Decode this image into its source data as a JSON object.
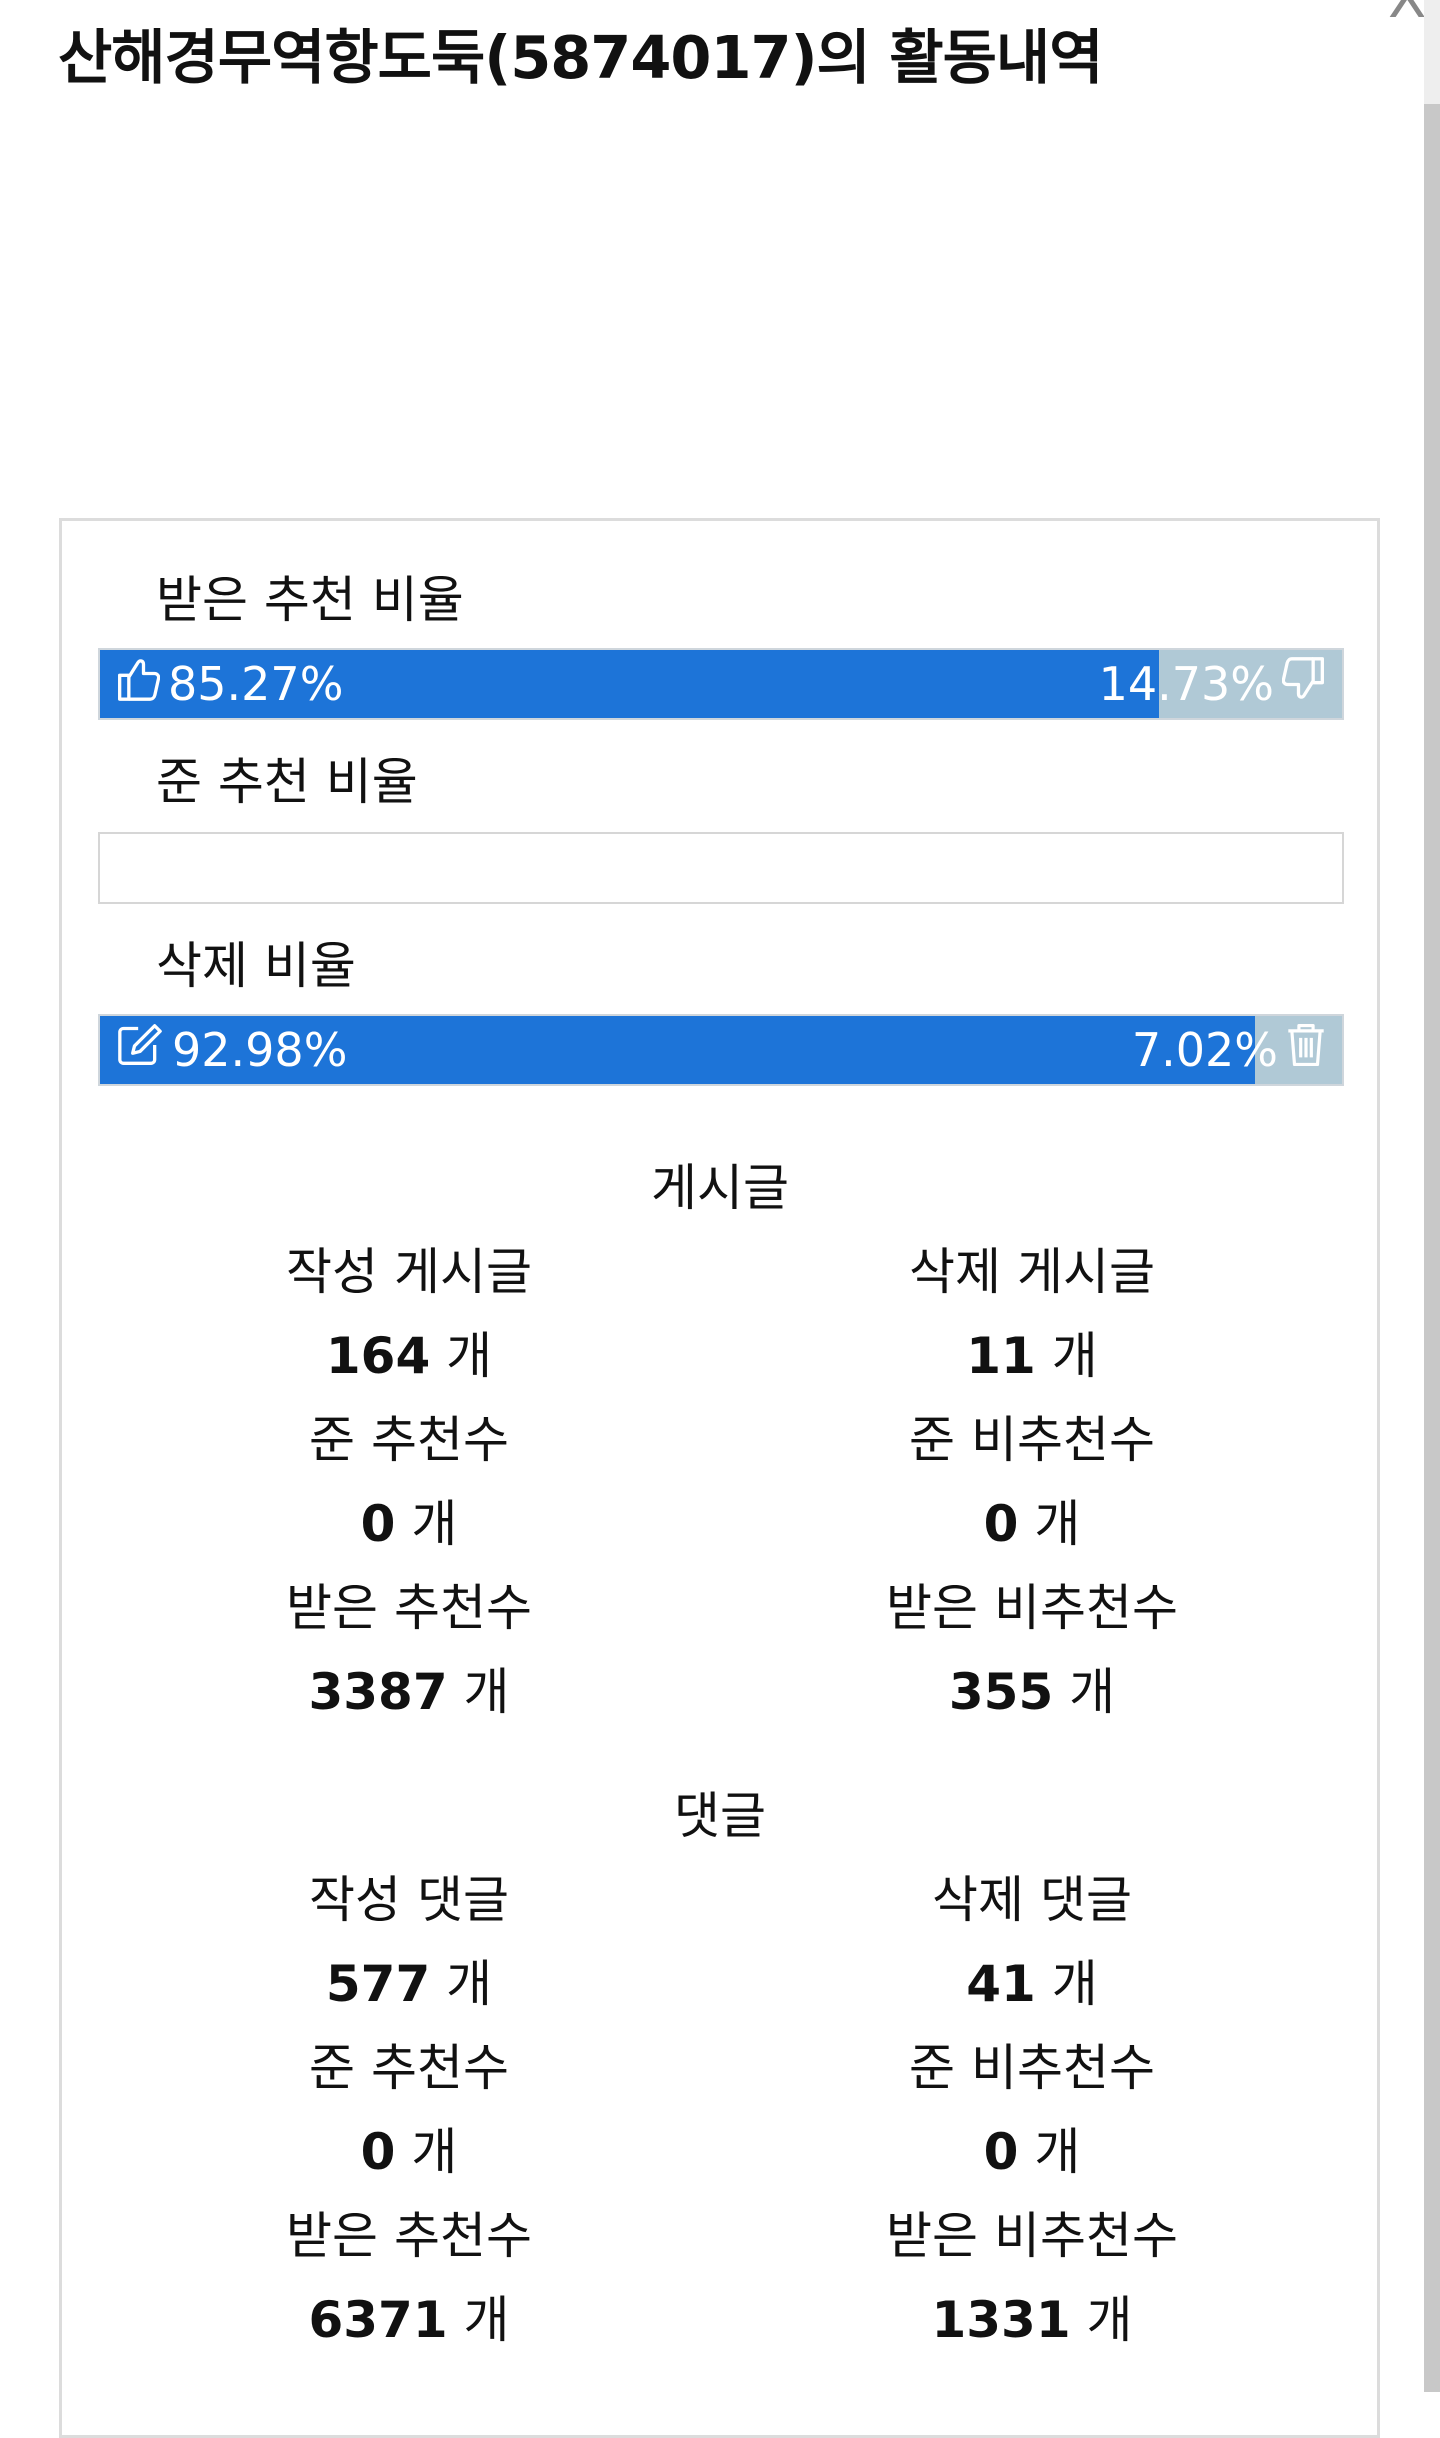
{
  "header": {
    "title": "산해경무역항도둑(5874017)의 활동내역",
    "close_label": "X"
  },
  "colors": {
    "bar_primary": "#1d74d8",
    "bar_secondary": "#b0c9d6",
    "panel_border": "#dcdcdc"
  },
  "ratios": {
    "received_recommend": {
      "label": "받은 추천 비율",
      "left_value": 85.27,
      "left_text": "85.27%",
      "left_icon": "thumbs-up-icon",
      "right_text": "14.73%",
      "right_icon": "thumbs-down-icon"
    },
    "given_recommend": {
      "label": "준 추천 비율"
    },
    "deleted": {
      "label": "삭제 비율",
      "left_value": 92.98,
      "left_text": "92.98%",
      "left_icon": "edit-icon",
      "right_text": "7.02%",
      "right_icon": "trash-icon"
    }
  },
  "posts": {
    "title": "게시글",
    "unit": "개",
    "written": {
      "label": "작성 게시글",
      "value": "164"
    },
    "deleted": {
      "label": "삭제 게시글",
      "value": "11"
    },
    "given_up": {
      "label": "준 추천수",
      "value": "0"
    },
    "given_down": {
      "label": "준 비추천수",
      "value": "0"
    },
    "received_up": {
      "label": "받은 추천수",
      "value": "3387"
    },
    "received_down": {
      "label": "받은 비추천수",
      "value": "355"
    }
  },
  "comments": {
    "title": "댓글",
    "unit": "개",
    "written": {
      "label": "작성 댓글",
      "value": "577"
    },
    "deleted": {
      "label": "삭제 댓글",
      "value": "41"
    },
    "given_up": {
      "label": "준 추천수",
      "value": "0"
    },
    "given_down": {
      "label": "준 비추천수",
      "value": "0"
    },
    "received_up": {
      "label": "받은 추천수",
      "value": "6371"
    },
    "received_down": {
      "label": "받은 비추천수",
      "value": "1331"
    }
  }
}
